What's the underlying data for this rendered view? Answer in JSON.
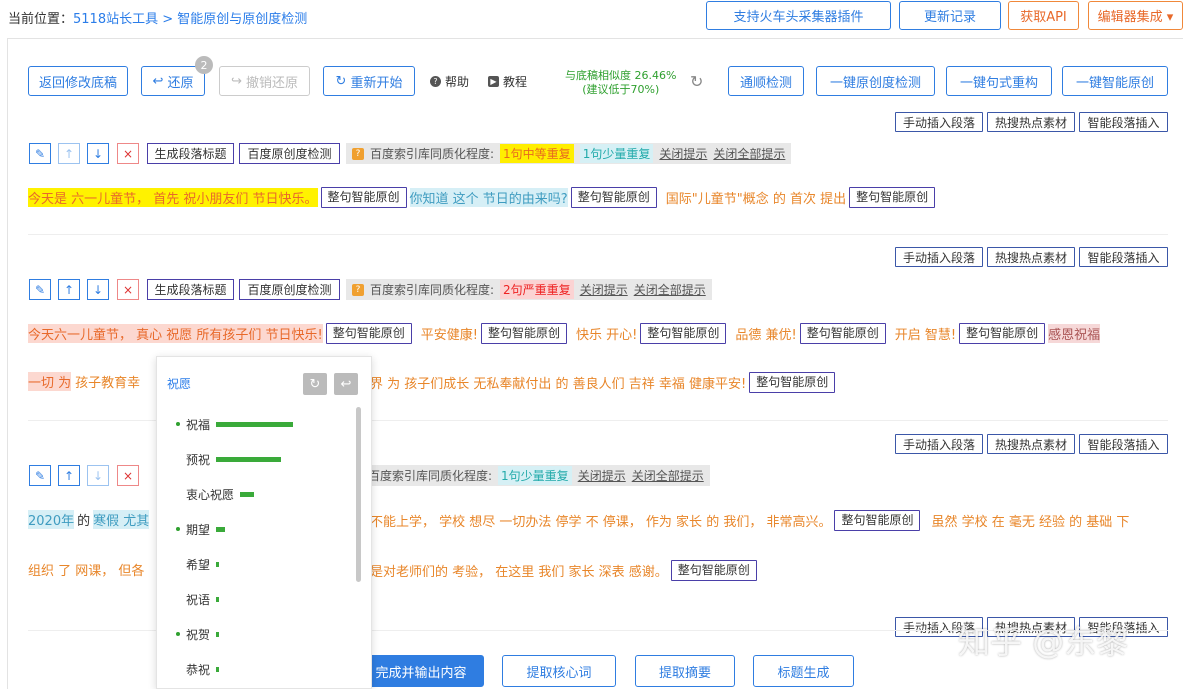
{
  "breadcrumb": {
    "prefix": "当前位置：",
    "home": "5118站长工具",
    "sep": " > ",
    "current": "智能原创与原创度检测"
  },
  "top_buttons": [
    "支持火车头采集器插件",
    "更新记录",
    "获取API",
    "编辑器集成 ▾"
  ],
  "toolbar": {
    "back": "返回修改底稿",
    "undo": "还原",
    "undo_badge": "2",
    "redo": "撤销还原",
    "restart": "重新开始",
    "help": "帮助",
    "tutorial": "教程",
    "similarity_line1": "与底稿相似度 26.46%",
    "similarity_line2": "(建议低于70%)",
    "fluency": "通顺检测",
    "check_all": "一键原创度检测",
    "restructure": "一键句式重构",
    "smart_all": "一键智能原创"
  },
  "insert_buttons": [
    "手动插入段落",
    "热搜热点素材",
    "智能段落插入"
  ],
  "para_buttons": {
    "gen_title": "生成段落标题",
    "baidu_check": "百度原创度检测"
  },
  "index_label": "百度索引库同质化程度:",
  "close_tip": "关闭提示",
  "close_all": "关闭全部提示",
  "sentence_btn": "整句智能原创",
  "p1": {
    "badge1": "1句中等重复",
    "badge2": "1句少量重复",
    "s1": "今天是 六一儿童节， 首先 祝小朋友们 节日快乐。",
    "s2": "你知道 这个 节日的由来吗?",
    "s3": "国际\"儿童节\"概念 的 首次 提出"
  },
  "p2": {
    "badge1": "2句严重重复",
    "line1": [
      "今天六一儿童节， 真心 祝愿 所有孩子们 节日快乐!",
      "平安健康!",
      "快乐 开心!",
      "品德 兼优!",
      "开启 智慧!",
      "感恩祝福"
    ],
    "line2a": "一切 为",
    "line2b": "孩子教育幸",
    "line2c": "界 为 孩子们成长 无私奉献付出 的 善良人们 吉祥 幸福 健康平安!"
  },
  "p3": {
    "badge1": "1句少量重复",
    "line1a": "2020年",
    "line1b": "的",
    "line1c": "寒假 尤其",
    "line1d": "不能上学， 学校 想尽 一切办法 停学 不 停课， 作为 家长 的 我们， 非常高兴。",
    "line1e": "虽然 学校 在 毫无 经验 的 基础 下",
    "line2a": "组织 了 网课， 但各",
    "line2b": "是对老师们的 考验， 在这里 我们 家长 深表 感谢。"
  },
  "popup": {
    "title": "祝愿",
    "items": [
      {
        "word": "祝福",
        "bullet": true,
        "strength": 0.85
      },
      {
        "word": "预祝",
        "bullet": false,
        "strength": 0.72
      },
      {
        "word": "衷心祝愿",
        "bullet": false,
        "strength": 0.15
      },
      {
        "word": "期望",
        "bullet": true,
        "strength": 0.1
      },
      {
        "word": "希望",
        "bullet": false,
        "strength": 0.03
      },
      {
        "word": "祝语",
        "bullet": false,
        "strength": 0.03
      },
      {
        "word": "祝贺",
        "bullet": true,
        "strength": 0.03
      },
      {
        "word": "恭祝",
        "bullet": false,
        "strength": 0.03
      }
    ]
  },
  "bottom": {
    "finish": "完成并输出内容",
    "keywords": "提取核心词",
    "summary": "提取摘要",
    "title_gen": "标题生成"
  },
  "watermark": "知乎 @东黎",
  "colors": {
    "accent": "#2f7de1",
    "orange": "#e8692a",
    "green": "#2fa02f"
  }
}
